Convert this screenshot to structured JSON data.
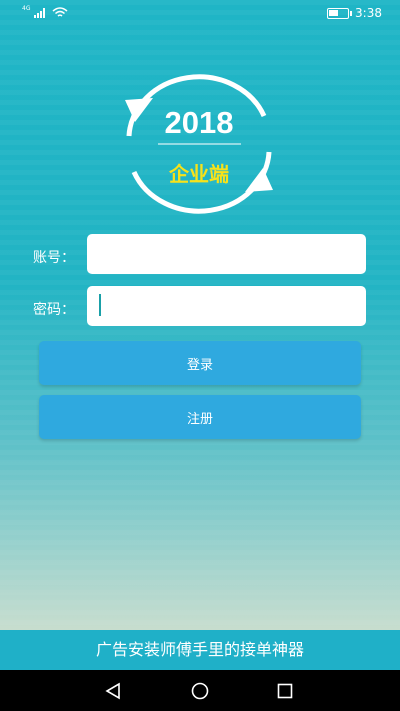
{
  "status_bar": {
    "network_label": "4G",
    "signal_icon": "signal-icon",
    "wifi_icon": "wifi-icon",
    "battery_icon": "battery-icon",
    "time": "3:38"
  },
  "logo": {
    "year": "2018",
    "subtitle": "企业端",
    "icon": "refresh-cycle-icon",
    "subtitle_color": "#f7e21a"
  },
  "form": {
    "account_label": "账号：",
    "account_value": "",
    "password_label": "密码：",
    "password_value": ""
  },
  "buttons": {
    "login_label": "登录",
    "register_label": "注册"
  },
  "tagline": "广告安装师傅手里的接单神器",
  "nav": {
    "back_icon": "back-triangle-icon",
    "home_icon": "home-circle-icon",
    "recents_icon": "recents-square-icon"
  },
  "colors": {
    "primary": "#22b4c4",
    "button": "#2fa9df",
    "tagline_bar": "#1fb0c8"
  }
}
